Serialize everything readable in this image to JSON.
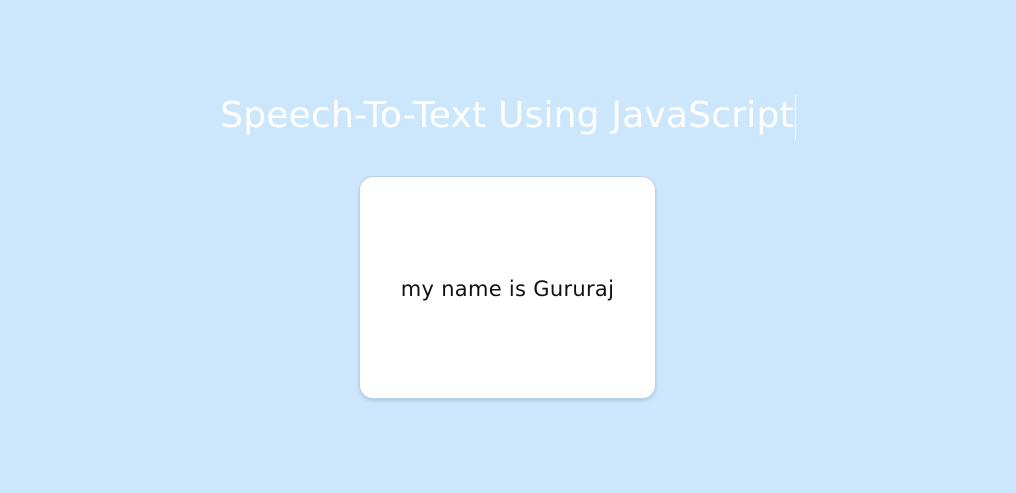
{
  "page": {
    "title": "Speech-To-Text Using JavaScript"
  },
  "card": {
    "transcript": "my name is Gururaj"
  },
  "colors": {
    "background": "#cce6fc",
    "title": "#ffffff",
    "card": "#ffffff",
    "text": "#111111"
  }
}
